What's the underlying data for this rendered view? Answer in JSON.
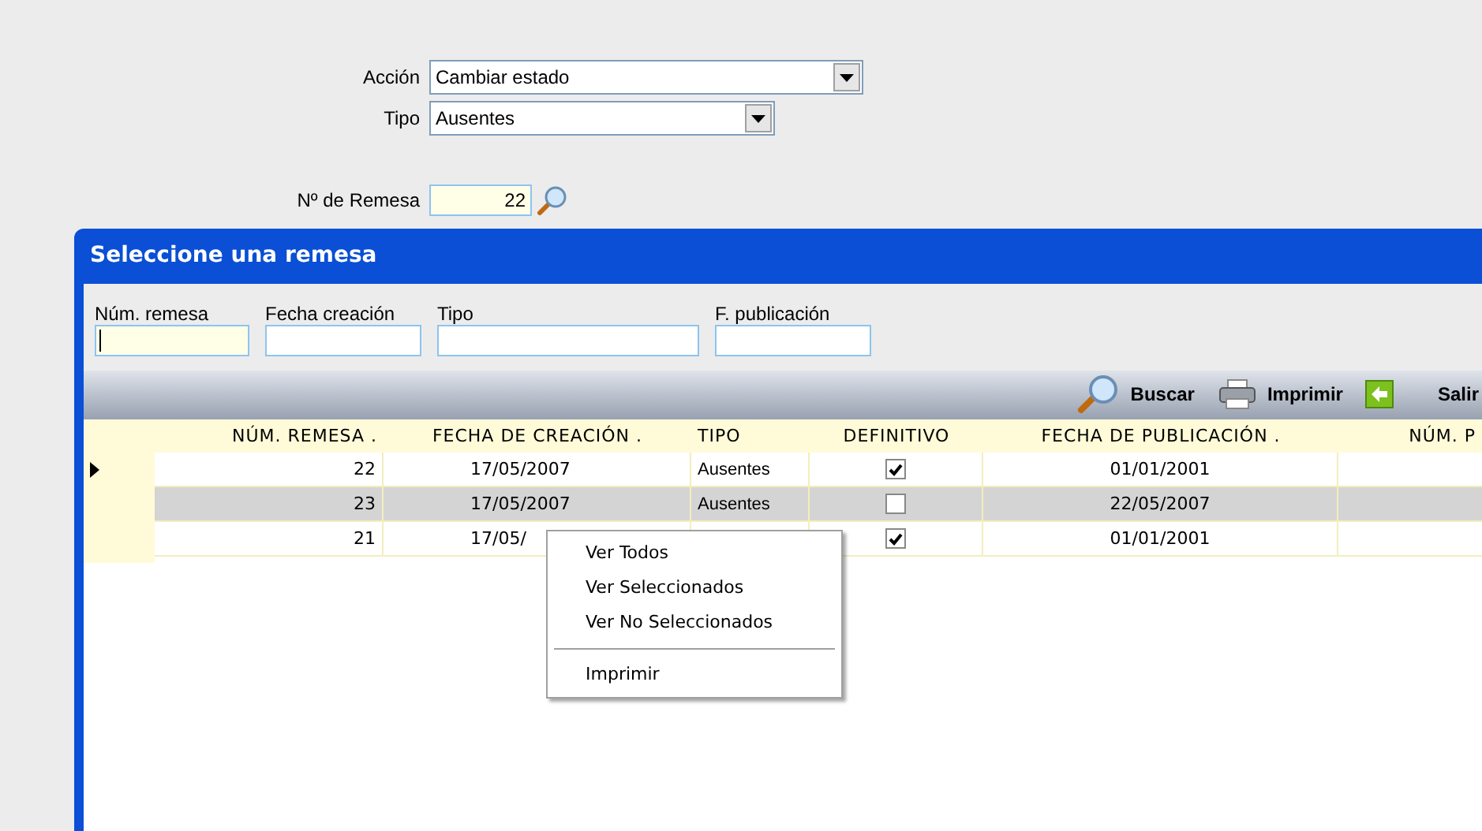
{
  "form": {
    "fields": [
      {
        "kind": "select",
        "label": "Acción",
        "value": "Cambiar estado"
      },
      {
        "kind": "select",
        "label": "Tipo",
        "value": "Ausentes"
      },
      {
        "kind": "lookup",
        "label": "Nº de Remesa",
        "value": "22"
      }
    ]
  },
  "dialog": {
    "title": "Seleccione una remesa",
    "filters": [
      {
        "label": "Núm. remesa",
        "focused": true
      },
      {
        "label": "Fecha creación",
        "focused": false
      },
      {
        "label": "Tipo",
        "focused": false
      },
      {
        "label": "F. publicación",
        "focused": false
      }
    ],
    "toolbar": [
      {
        "kind": "search",
        "label": "Buscar"
      },
      {
        "kind": "print",
        "label": "Imprimir"
      },
      {
        "kind": "exit",
        "label": "Salir"
      }
    ],
    "grid": {
      "columns": [
        "NÚM. REMESA .",
        "FECHA DE CREACIÓN .",
        "TIPO",
        "DEFINITIVO",
        "FECHA DE PUBLICACIÓN .",
        "NÚM. P"
      ],
      "rows": [
        {
          "current": true,
          "selected": false,
          "number": "22",
          "created": "17/05/2007",
          "type": "Ausentes",
          "definitive": true,
          "published": "01/01/2001"
        },
        {
          "current": false,
          "selected": true,
          "number": "23",
          "created": "17/05/2007",
          "type": "Ausentes",
          "definitive": false,
          "published": "22/05/2007"
        },
        {
          "current": false,
          "selected": false,
          "number": "21",
          "created": "17/05/",
          "definitive": true,
          "published": "01/01/2001"
        }
      ]
    },
    "context_menu": {
      "items": [
        {
          "kind": "item",
          "label": "Ver Todos"
        },
        {
          "kind": "item",
          "label": "Ver Seleccionados"
        },
        {
          "kind": "item",
          "label": "Ver No Seleccionados"
        },
        {
          "kind": "separator"
        },
        {
          "kind": "item",
          "label": "Imprimir"
        }
      ]
    }
  }
}
